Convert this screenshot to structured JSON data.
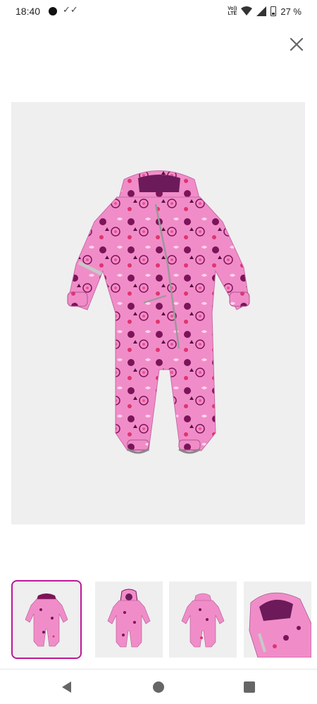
{
  "status_bar": {
    "time": "18:40",
    "notification_icon": "double-check-icon",
    "network_label": "Vo))\nLTE",
    "battery_percent": "27 %"
  },
  "header": {
    "close_icon": "close-icon"
  },
  "product_image": {
    "description_icon": "snowsuit-image",
    "background_color": "#efefef",
    "suit_color": "#f08dc9",
    "accent_color": "#7b1458"
  },
  "thumbnails": [
    {
      "view": "front",
      "selected": true
    },
    {
      "view": "front-hood-up",
      "selected": false
    },
    {
      "view": "back",
      "selected": false
    },
    {
      "view": "hood-detail",
      "selected": false
    }
  ],
  "selected_thumb_color": "#c0169a",
  "nav_bar": {
    "back_icon": "back-triangle-icon",
    "home_icon": "home-circle-icon",
    "recents_icon": "recents-square-icon"
  }
}
